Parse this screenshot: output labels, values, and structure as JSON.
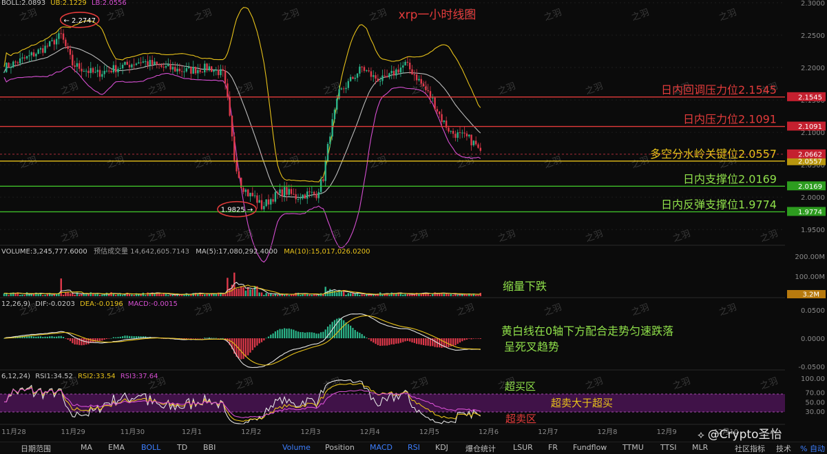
{
  "chart_data": [
    {
      "type": "candlestick",
      "title": "xrp一小时线图",
      "indicator_header": {
        "label": "BOLL:2.0893",
        "ub": "UB:2.1229",
        "lb": "LB:2.0556"
      },
      "y_ticks": [
        "2.3000",
        "2.2500",
        "2.2000",
        "2.1500",
        "2.1000",
        "2.0500",
        "2.0000",
        "1.9500"
      ],
      "ylim": [
        1.93,
        2.3
      ],
      "x_ticks": [
        "11月28",
        "11月29",
        "11月30",
        "12月1",
        "12月2",
        "12月3",
        "12月4",
        "12月5",
        "12月6",
        "12月7",
        "12月8",
        "12月9",
        "12月10"
      ],
      "high_marker": {
        "label": "← 2.2747",
        "value": 2.2747
      },
      "low_marker": {
        "label": "1.9825 →",
        "value": 1.9825
      },
      "levels": [
        {
          "label": "日内回调压力位2.1545",
          "value": 2.1545,
          "tag": "2.1545",
          "color": "#e33b3b"
        },
        {
          "label": "日内压力位2.1091",
          "value": 2.1091,
          "tag": "2.1091",
          "color": "#e33b3b"
        },
        {
          "label": "多空分水岭关键位2.0557",
          "value": 2.0557,
          "tag": "2.0557",
          "color": "#e8c21a"
        },
        {
          "label": "日内支撑位2.0169",
          "value": 2.0169,
          "tag": "2.0169",
          "color": "#3fbf2a"
        },
        {
          "label": "日内反弹支撑位1.9774",
          "value": 1.9774,
          "tag": "1.9774",
          "color": "#3fbf2a"
        }
      ],
      "last_price": {
        "value": 2.0662,
        "tag": "2.0662"
      },
      "price_anchors": [
        [
          0,
          2.2
        ],
        [
          10,
          2.215
        ],
        [
          20,
          2.235
        ],
        [
          25,
          2.25
        ],
        [
          30,
          2.205
        ],
        [
          40,
          2.19
        ],
        [
          50,
          2.2
        ],
        [
          60,
          2.21
        ],
        [
          70,
          2.2
        ],
        [
          80,
          2.195
        ],
        [
          90,
          2.2
        ],
        [
          96,
          2.19
        ],
        [
          98,
          2.15
        ],
        [
          101,
          2.06
        ],
        [
          104,
          2.02
        ],
        [
          107,
          2.005
        ],
        [
          110,
          2.0
        ],
        [
          113,
          1.985
        ],
        [
          118,
          2.0
        ],
        [
          123,
          2.01
        ],
        [
          128,
          2.0
        ],
        [
          133,
          2.005
        ],
        [
          137,
          2.005
        ],
        [
          140,
          2.03
        ],
        [
          143,
          2.1
        ],
        [
          147,
          2.16
        ],
        [
          152,
          2.18
        ],
        [
          157,
          2.2
        ],
        [
          162,
          2.185
        ],
        [
          167,
          2.18
        ],
        [
          172,
          2.195
        ],
        [
          176,
          2.205
        ],
        [
          180,
          2.19
        ],
        [
          184,
          2.17
        ],
        [
          188,
          2.15
        ],
        [
          192,
          2.12
        ],
        [
          196,
          2.1
        ],
        [
          200,
          2.095
        ],
        [
          204,
          2.09
        ],
        [
          207,
          2.08
        ],
        [
          209,
          2.066
        ]
      ]
    },
    {
      "type": "bar",
      "title": "VOLUME:3,245,777.6000",
      "est_label": "预估成交量 14,642,605.7143",
      "ma5": "MA(5):17,080,292.4000",
      "ma10": "MA(10):15,017,026.0200",
      "y_ticks": [
        "200.00M",
        "100.00M"
      ],
      "last_tag": "3.2M",
      "annotation": "缩量下跌"
    },
    {
      "type": "bar",
      "title": "MACD",
      "params": "12,26,9)",
      "dif": "DIF:-0.0203",
      "dea": "DEA:-0.0196",
      "macd": "MACD:-0.0015",
      "y_ticks": [
        "0.0500",
        "0.0000",
        "-0.0500"
      ],
      "annotation_1": "黄白线在0轴下方配合走势匀速跌落",
      "annotation_2": "呈死叉趋势"
    },
    {
      "type": "line",
      "title": "RSI",
      "params": "6,12,24)",
      "rsi1": "RSI1:34.52",
      "rsi2": "RSI2:33.54",
      "rsi3": "RSI3:37.64",
      "y_ticks": [
        "100.00",
        "70.00",
        "50.00",
        "30.00"
      ],
      "overbought_label": "超买区",
      "middle_label": "超卖大于超买",
      "oversold_label": "超卖区"
    }
  ],
  "watermark": "之羽",
  "brand": "@Crypto圣怡",
  "toolbar": {
    "range": "日期范围",
    "items": [
      "MA",
      "EMA",
      "BOLL",
      "TD",
      "BBI",
      "Volume",
      "Position",
      "MACD",
      "RSI",
      "KDJ",
      "爆仓统计",
      "LSUR",
      "FR",
      "Fundflow",
      "TTMU",
      "TTSI",
      "MLR",
      "社区指标",
      "技术",
      "% 自动"
    ]
  }
}
